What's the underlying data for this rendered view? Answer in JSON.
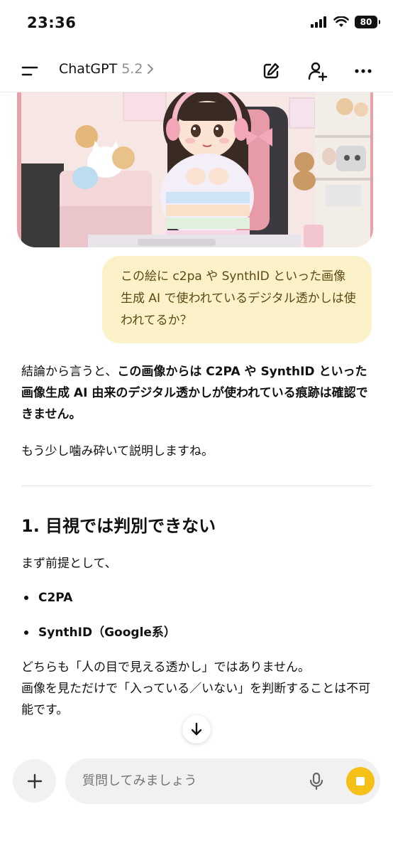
{
  "status": {
    "time": "23:36",
    "battery": "80"
  },
  "header": {
    "title": "ChatGPT",
    "version": "5.2"
  },
  "user_message": "この絵に c2pa や SynthID といった画像生成 AI で使われているデジタル透かしは使われてるか？",
  "answer": {
    "intro_prefix": "結論から言うと、",
    "intro_bold": "この画像からは C2PA や SynthID といった画像生成 AI 由来のデジタル透かしが使われている痕跡は確認できません。",
    "p2": "もう少し噛み砕いて説明しますね。",
    "heading": "1. 目視では判別できない",
    "premise": "まず前提として、",
    "bullets": [
      "C2PA",
      "SynthID（Google系）"
    ],
    "body_line1": "どちらも「人の目で見える透かし」ではありません。",
    "body_line2": "画像を見ただけで「入っている／いない」を判断することは不可能です。"
  },
  "composer": {
    "placeholder": "質問してみましょう"
  },
  "colors": {
    "accent": "#f5c017",
    "bubble": "#fbf2c9",
    "bubble_text": "#5b4a12"
  },
  "icons": [
    "menu-icon",
    "chevron-right-icon",
    "edit-icon",
    "add-person-icon",
    "more-icon",
    "arrow-down-icon",
    "plus-icon",
    "mic-icon",
    "stop-icon",
    "signal-icon",
    "wifi-icon",
    "battery-icon"
  ]
}
